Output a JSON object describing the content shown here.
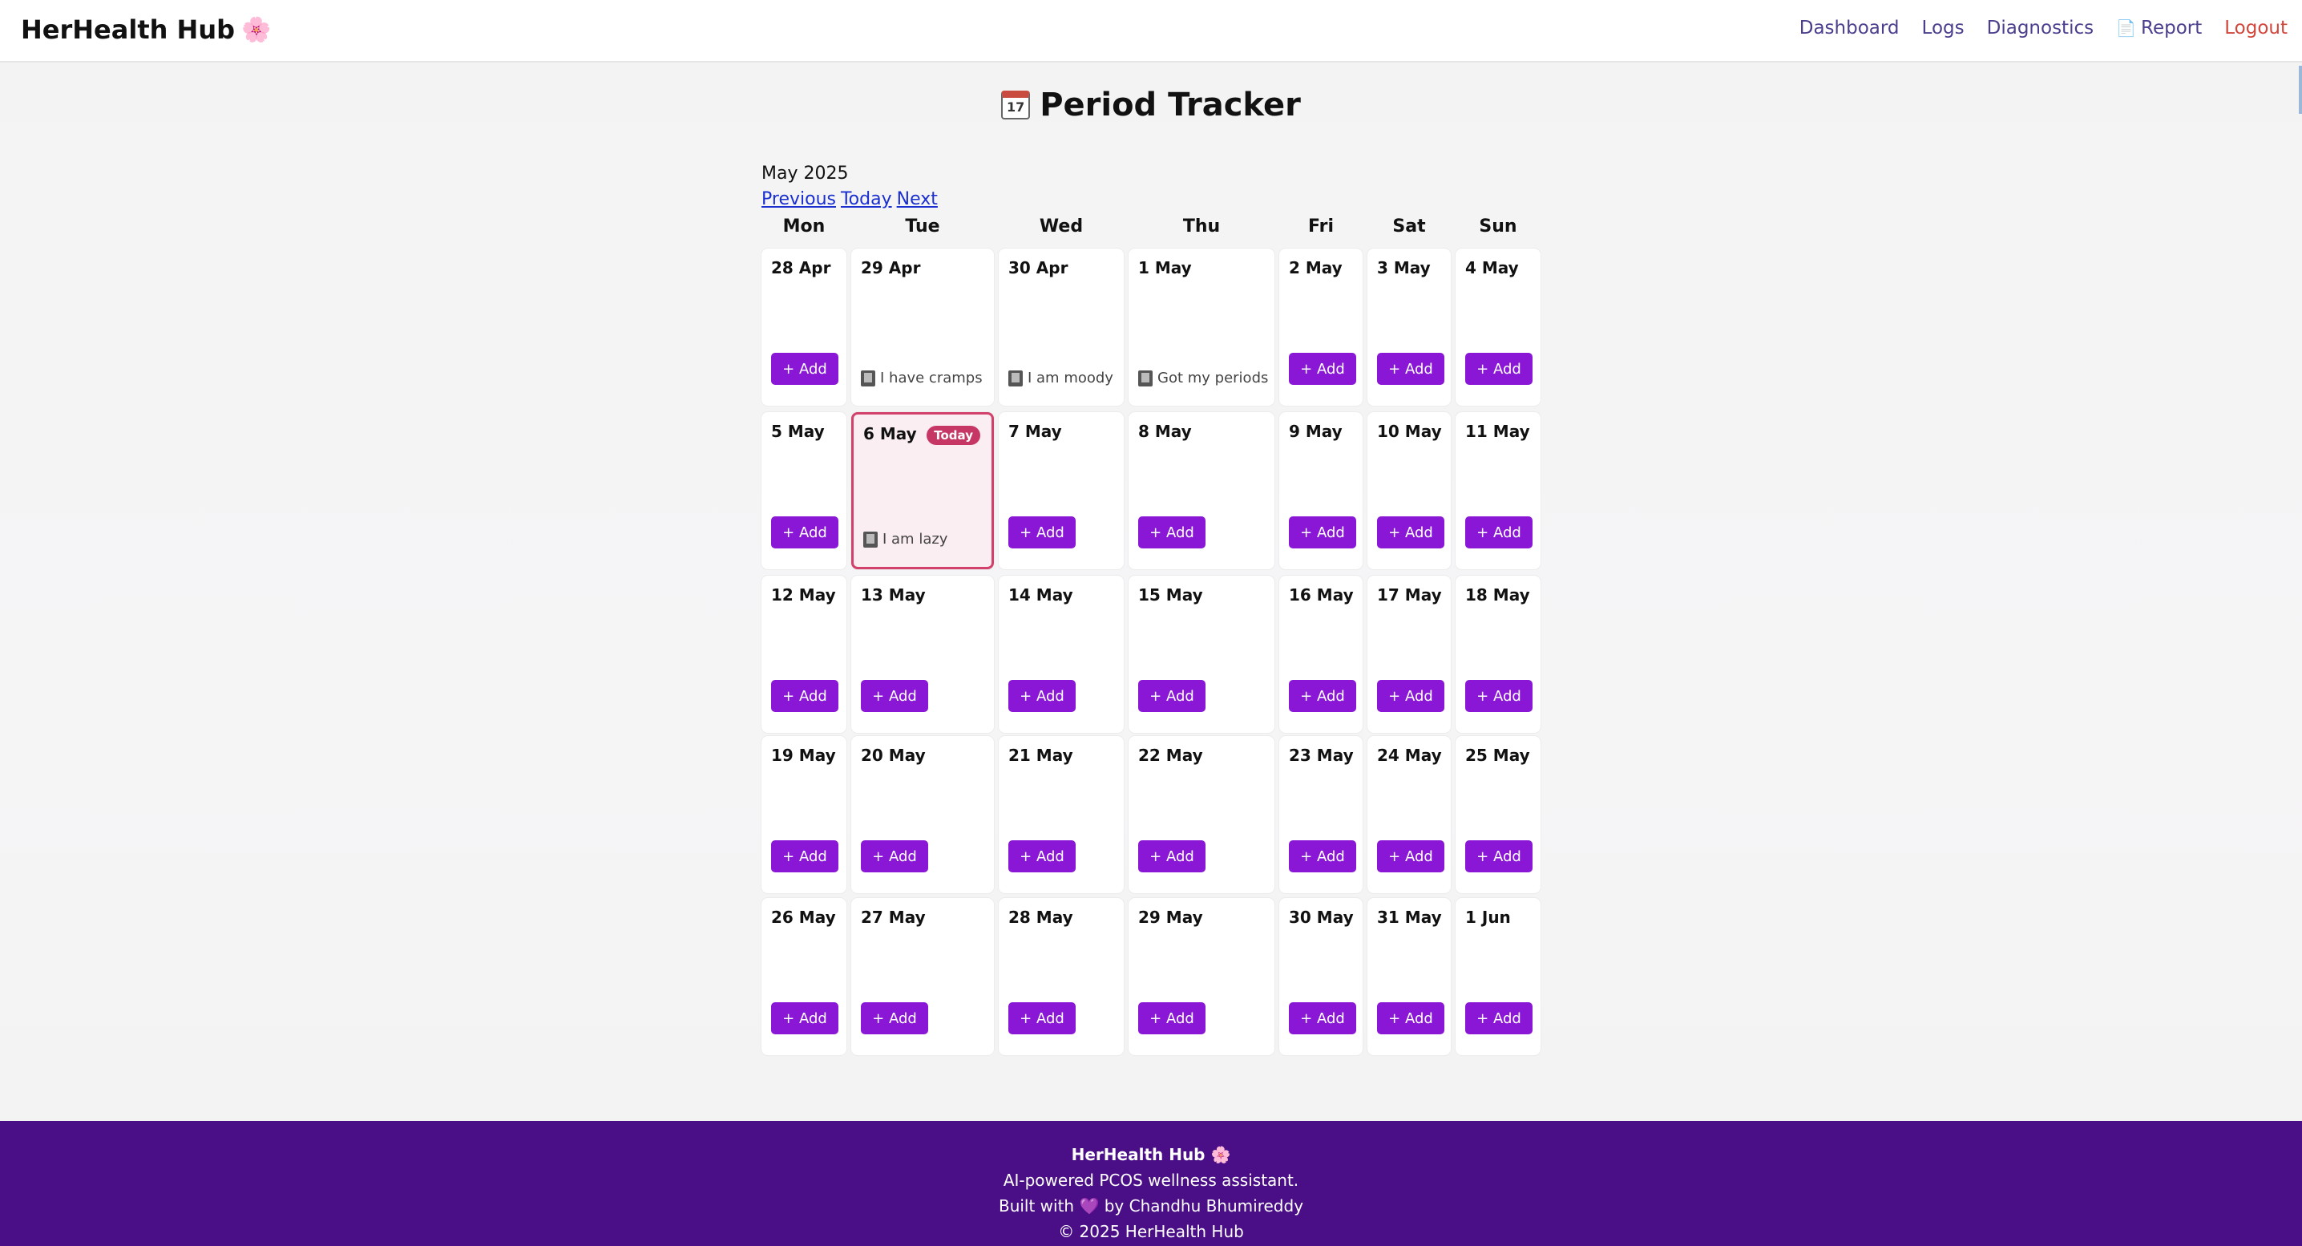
{
  "header": {
    "brand": "HerHealth Hub",
    "brand_icon": "🌸",
    "nav": {
      "dashboard": "Dashboard",
      "logs": "Logs",
      "diagnostics": "Diagnostics",
      "report": "Report",
      "logout": "Logout"
    },
    "nav_colors": {
      "link": "#4a3f8c",
      "logout": "#d0463b"
    }
  },
  "page": {
    "title": "Period Tracker",
    "title_icon": "calendar-icon",
    "calendar_icon_text": "17"
  },
  "calendar": {
    "month_label": "May 2025",
    "nav": {
      "previous": "Previous",
      "today": "Today",
      "next": "Next"
    },
    "days_of_week": [
      "Mon",
      "Tue",
      "Wed",
      "Thu",
      "Fri",
      "Sat",
      "Sun"
    ],
    "add_label": "+ Add",
    "today_badge": "Today",
    "accent_color": "#8a17d6",
    "weeks": [
      [
        {
          "date": "28 Apr",
          "note": null
        },
        {
          "date": "29 Apr",
          "note": "I have cramps"
        },
        {
          "date": "30 Apr",
          "note": "I am moody"
        },
        {
          "date": "1 May",
          "note": "Got my periods"
        },
        {
          "date": "2 May",
          "note": null
        },
        {
          "date": "3 May",
          "note": null
        },
        {
          "date": "4 May",
          "note": null
        }
      ],
      [
        {
          "date": "5 May",
          "note": null
        },
        {
          "date": "6 May",
          "note": "I am lazy",
          "today": true
        },
        {
          "date": "7 May",
          "note": null
        },
        {
          "date": "8 May",
          "note": null
        },
        {
          "date": "9 May",
          "note": null
        },
        {
          "date": "10 May",
          "note": null
        },
        {
          "date": "11 May",
          "note": null
        }
      ],
      [
        {
          "date": "12 May",
          "note": null
        },
        {
          "date": "13 May",
          "note": null
        },
        {
          "date": "14 May",
          "note": null
        },
        {
          "date": "15 May",
          "note": null
        },
        {
          "date": "16 May",
          "note": null
        },
        {
          "date": "17 May",
          "note": null
        },
        {
          "date": "18 May",
          "note": null
        }
      ],
      [
        {
          "date": "19 May",
          "note": null
        },
        {
          "date": "20 May",
          "note": null
        },
        {
          "date": "21 May",
          "note": null
        },
        {
          "date": "22 May",
          "note": null
        },
        {
          "date": "23 May",
          "note": null
        },
        {
          "date": "24 May",
          "note": null
        },
        {
          "date": "25 May",
          "note": null
        }
      ],
      [
        {
          "date": "26 May",
          "note": null
        },
        {
          "date": "27 May",
          "note": null
        },
        {
          "date": "28 May",
          "note": null
        },
        {
          "date": "29 May",
          "note": null
        },
        {
          "date": "30 May",
          "note": null
        },
        {
          "date": "31 May",
          "note": null
        },
        {
          "date": "1 Jun",
          "note": null
        }
      ]
    ]
  },
  "footer": {
    "brand": "HerHealth Hub",
    "brand_icon": "🌸",
    "tagline": "AI-powered PCOS wellness assistant.",
    "built_prefix": "Built with",
    "heart": "💜",
    "built_suffix": "by Chandhu Bhumireddy",
    "copyright": "© 2025 HerHealth Hub"
  }
}
